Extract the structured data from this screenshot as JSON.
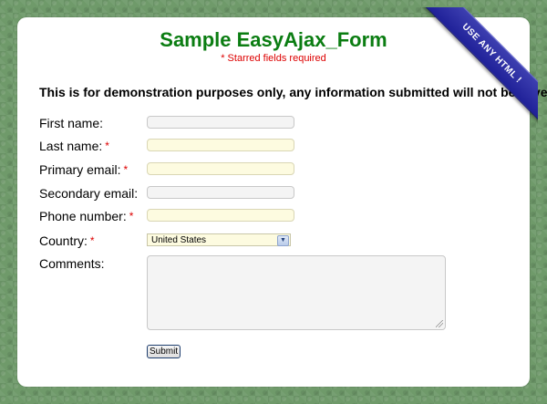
{
  "title": "Sample EasyAjax_Form",
  "subtitle": "* Starred fields required",
  "notice": "This is for demonstration purposes only, any information submitted will not be saved.",
  "ribbon": "USE ANY HTML !",
  "form": {
    "first_name_label": "First name:",
    "last_name_label": "Last name:",
    "primary_email_label": "Primary email:",
    "secondary_email_label": "Secondary email:",
    "phone_label": "Phone number:",
    "country_label": "Country:",
    "comments_label": "Comments:",
    "required_marker": "*",
    "country_selected": "United States",
    "submit_label": "Submit"
  },
  "colors": {
    "title": "#0b7d12",
    "required": "#dd0000",
    "required_field_bg": "#fdfbe0",
    "ribbon": "#2426a3"
  }
}
